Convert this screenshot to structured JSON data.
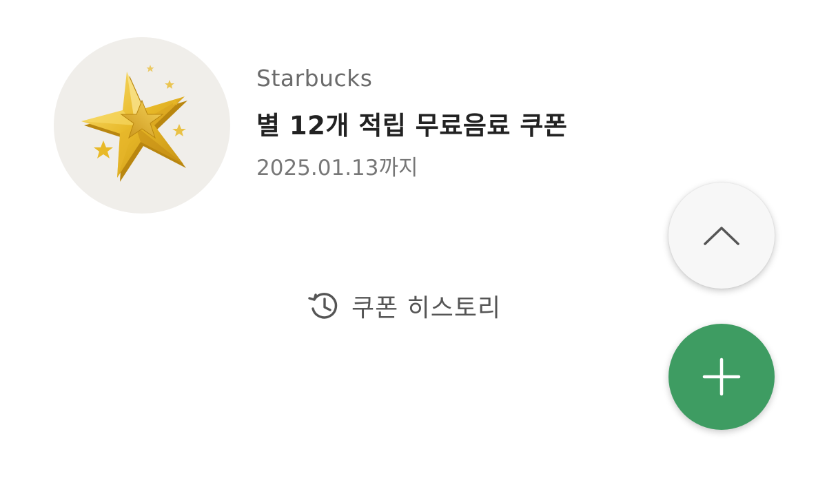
{
  "coupon": {
    "thumbnail_icon": "gold-stars-icon",
    "brand": "Starbucks",
    "title": "별 12개 적립 무료음료 쿠폰",
    "expiry": "2025.01.13까지"
  },
  "history": {
    "icon": "history-clock-icon",
    "label": "쿠폰 히스토리"
  },
  "fabs": {
    "scroll_up_icon": "chevron-up-icon",
    "add_icon": "plus-icon"
  },
  "colors": {
    "background": "#ffffff",
    "thumbnail_bg": "#f0eeea",
    "star_gold": "#e8b928",
    "fab_add": "#3e9c62",
    "fab_up": "#f7f7f7",
    "title_text": "#222222",
    "secondary_text": "#6b6b6b"
  }
}
